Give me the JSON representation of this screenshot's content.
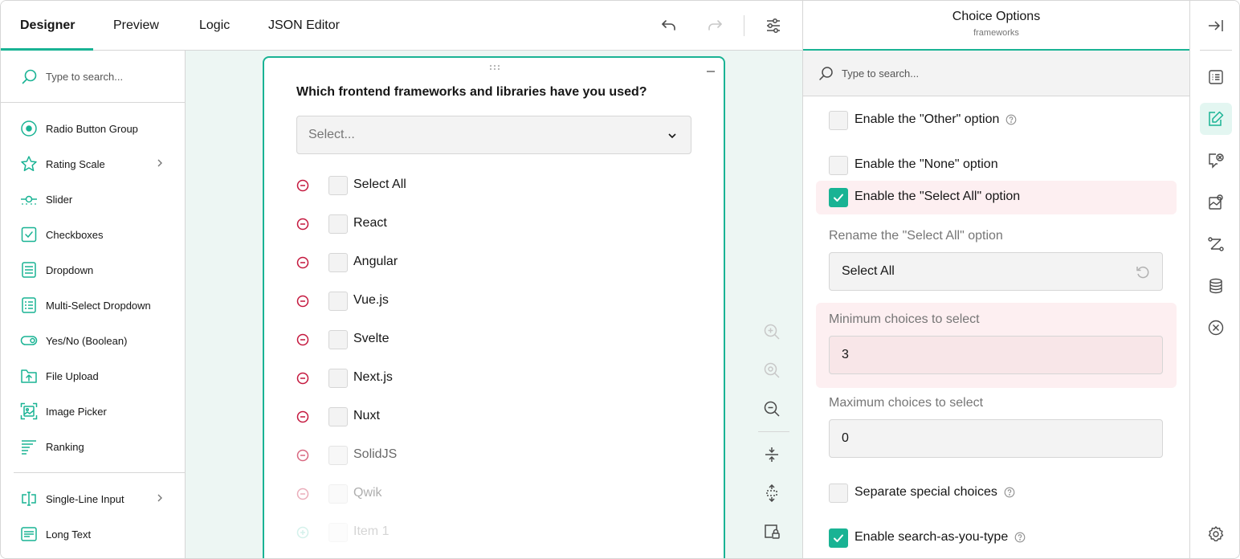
{
  "tabs": [
    {
      "label": "Designer",
      "active": true
    },
    {
      "label": "Preview"
    },
    {
      "label": "Logic"
    },
    {
      "label": "JSON Editor"
    }
  ],
  "toolbar": {
    "undo_icon": "undo-icon",
    "redo_icon": "redo-icon",
    "settings_icon": "settings-sliders-icon"
  },
  "toolbox": {
    "search_placeholder": "Type to search...",
    "items": [
      {
        "label": "Radio Button Group",
        "icon": "radio-icon"
      },
      {
        "label": "Rating Scale",
        "icon": "star-icon",
        "has_submenu": true
      },
      {
        "label": "Slider",
        "icon": "slider-icon"
      },
      {
        "label": "Checkboxes",
        "icon": "checkbox-icon"
      },
      {
        "label": "Dropdown",
        "icon": "dropdown-icon"
      },
      {
        "label": "Multi-Select Dropdown",
        "icon": "multi-dropdown-icon"
      },
      {
        "label": "Yes/No (Boolean)",
        "icon": "toggle-icon"
      },
      {
        "label": "File Upload",
        "icon": "file-upload-icon"
      },
      {
        "label": "Image Picker",
        "icon": "image-picker-icon"
      },
      {
        "label": "Ranking",
        "icon": "ranking-icon"
      },
      {
        "label": "Single-Line Input",
        "icon": "text-input-icon",
        "has_submenu": true
      },
      {
        "label": "Long Text",
        "icon": "long-text-icon"
      }
    ]
  },
  "question": {
    "title": "Which frontend frameworks and libraries have you used?",
    "placeholder": "Select...",
    "choices": [
      {
        "label": "Select All"
      },
      {
        "label": "React"
      },
      {
        "label": "Angular"
      },
      {
        "label": "Vue.js"
      },
      {
        "label": "Svelte"
      },
      {
        "label": "Next.js"
      },
      {
        "label": "Nuxt"
      },
      {
        "label": "SolidJS"
      },
      {
        "label": "Qwik"
      },
      {
        "label": "Item 1"
      }
    ]
  },
  "properties": {
    "title": "Choice Options",
    "subtitle": "frameworks",
    "search_placeholder": "Type to search...",
    "enable_other": {
      "label": "Enable the \"Other\" option",
      "checked": false
    },
    "enable_none": {
      "label": "Enable the \"None\" option",
      "checked": false
    },
    "enable_select_all": {
      "label": "Enable the \"Select All\" option",
      "checked": true
    },
    "rename_select_all": {
      "label": "Rename the \"Select All\" option",
      "value": "Select All"
    },
    "min_choices": {
      "label": "Minimum choices to select",
      "value": "3"
    },
    "max_choices": {
      "label": "Maximum choices to select",
      "value": "0"
    },
    "separate_special": {
      "label": "Separate special choices",
      "checked": false
    },
    "search_as_you_type": {
      "label": "Enable search-as-you-type",
      "checked": true
    }
  },
  "colors": {
    "accent": "#19b394",
    "danger": "#c4173d",
    "highlight": "#fdeff1"
  }
}
